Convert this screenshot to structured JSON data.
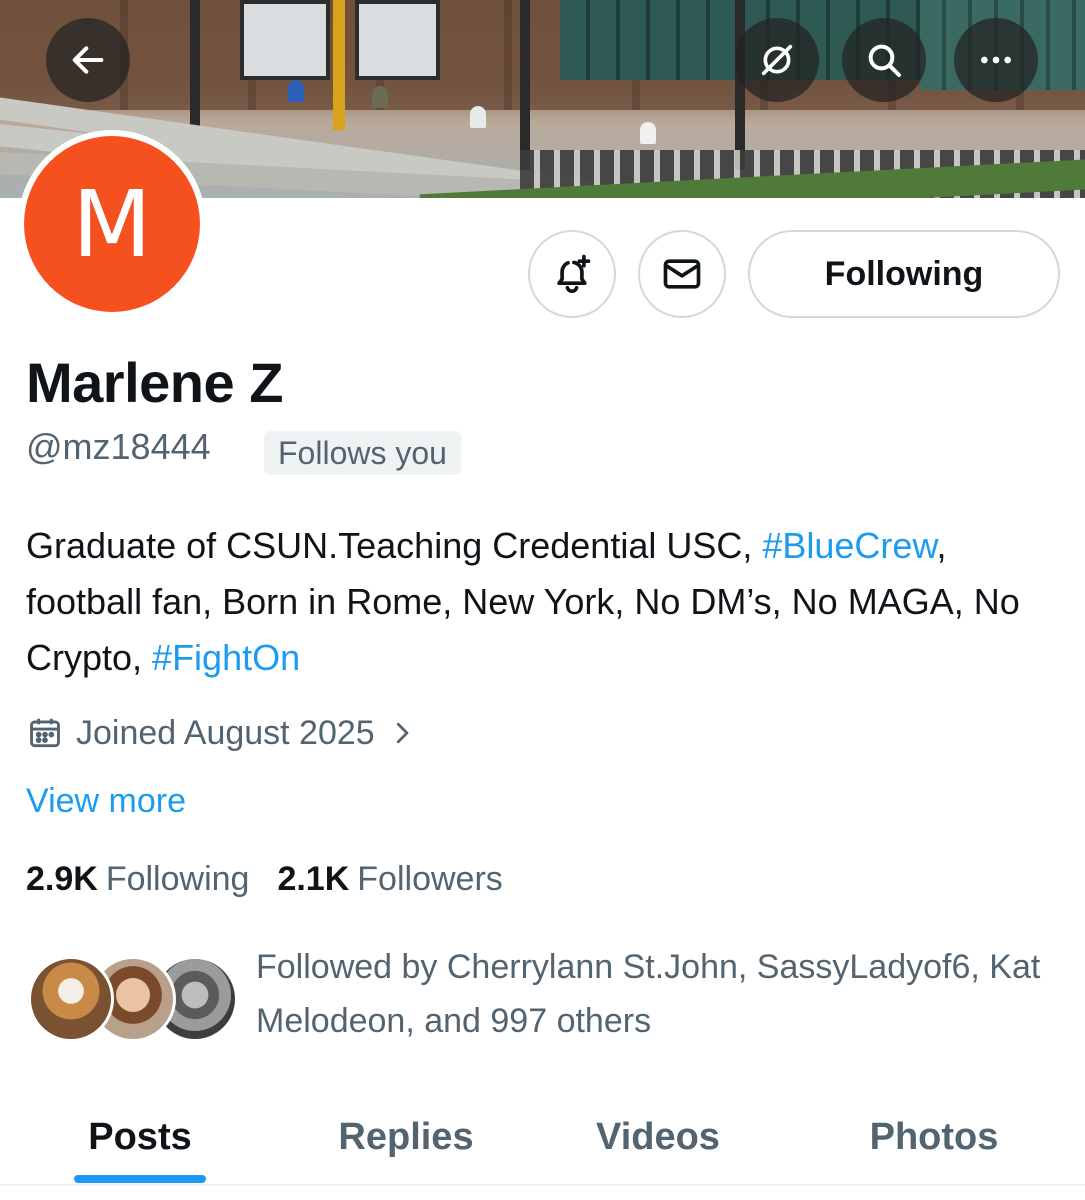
{
  "header": {
    "back_icon": "arrow-left-icon",
    "grok_icon": "grok-icon",
    "search_icon": "search-icon",
    "more_icon": "more-horizontal-icon"
  },
  "profile": {
    "avatar_letter": "M",
    "avatar_color": "#f4511e",
    "display_name": "Marlene Z",
    "handle": "@mz18444",
    "follows_you": "Follows you",
    "bio_part1": "Graduate of CSUN.Teaching Credential USC, ",
    "bio_hashtag1": "#BlueCrew",
    "bio_part2": ", football fan, Born in Rome, New York, No DM’s, No MAGA, No Crypto, ",
    "bio_hashtag2": "#FightOn",
    "joined": "Joined August 2025",
    "view_more": "View more",
    "following_count": "2.9K",
    "following_label": "Following",
    "followers_count": "2.1K",
    "followers_label": "Followers",
    "followed_by": "Followed by Cherrylann St.John, SassyLadyof6, Kat Melodeon, and 997 others"
  },
  "actions": {
    "notify_icon": "bell-plus-icon",
    "message_icon": "envelope-icon",
    "following_label": "Following"
  },
  "tabs": [
    {
      "label": "Posts",
      "active": true
    },
    {
      "label": "Replies",
      "active": false
    },
    {
      "label": "Videos",
      "active": false
    },
    {
      "label": "Photos",
      "active": false
    }
  ],
  "colors": {
    "accent": "#1d9bf0",
    "text_primary": "#0f1419",
    "text_secondary": "#536471",
    "border": "#cfd9de"
  }
}
